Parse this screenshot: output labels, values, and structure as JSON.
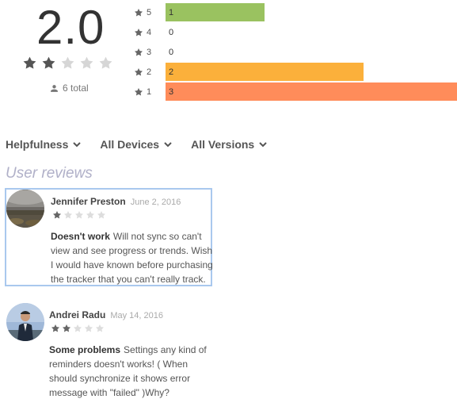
{
  "summary": {
    "score": "2.0",
    "star_rating": 2,
    "total_label": "6 total",
    "total_icon": "person-icon"
  },
  "histogram": [
    {
      "star": "5",
      "count": "1",
      "fraction": 0.3333,
      "color": "#9ac260"
    },
    {
      "star": "4",
      "count": "0",
      "fraction": 0,
      "color": "#9ac260"
    },
    {
      "star": "3",
      "count": "0",
      "fraction": 0,
      "color": "#f9c22e"
    },
    {
      "star": "2",
      "count": "2",
      "fraction": 0.6667,
      "color": "#fbb03b"
    },
    {
      "star": "1",
      "count": "3",
      "fraction": 1.0,
      "color": "#ff8c5a"
    }
  ],
  "filters": [
    {
      "label": "Helpfulness",
      "icon": "chevron-down-icon"
    },
    {
      "label": "All Devices",
      "icon": "chevron-down-icon"
    },
    {
      "label": "All Versions",
      "icon": "chevron-down-icon"
    }
  ],
  "section_title": "User reviews",
  "reviews": [
    {
      "author": "Jennifer Preston",
      "date": "June 2, 2016",
      "rating": 1,
      "title": "Doesn't work",
      "text": "Will not sync so can't view and see progress or trends. Wish I would have known before purchasing the tracker that you can't really track.",
      "selected": true
    },
    {
      "author": "Andrei Radu",
      "date": "May 14, 2016",
      "rating": 2,
      "title": "Some problems",
      "text": "Settings any kind of reminders doesn't works! ( When should synchronize it shows error message with \"failed\" )Why?",
      "selected": false
    }
  ],
  "colors": {
    "star_filled": "#555555",
    "star_empty": "#d6d6d6",
    "small_star_filled": "#666666",
    "small_star_empty": "#dddddd",
    "selected_border": "#a9c8ee"
  }
}
